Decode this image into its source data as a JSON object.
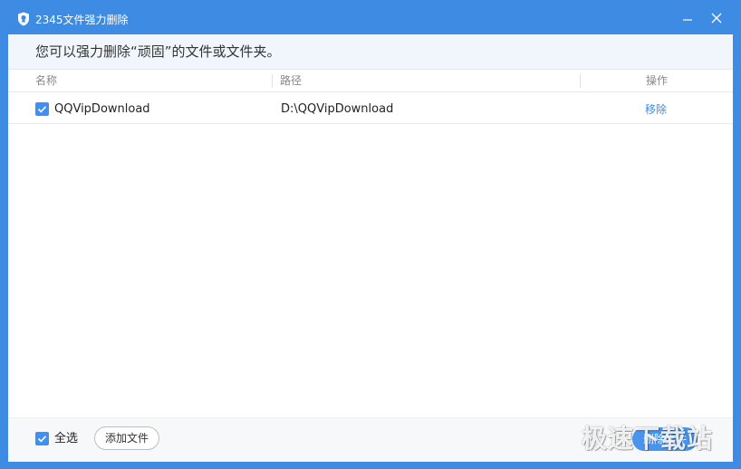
{
  "window": {
    "title": "2345文件强力删除",
    "icon": "shield-icon",
    "controls": [
      "minimize-icon",
      "close-icon"
    ]
  },
  "intro": {
    "text": "您可以强力删除“顽固”的文件或文件夹。"
  },
  "table": {
    "columns": [
      "名称",
      "路径",
      "操作"
    ],
    "rows": [
      {
        "checked": true,
        "name": "QQVipDownload",
        "path": "D:\\QQVipDownload",
        "action": "移除"
      }
    ]
  },
  "footer": {
    "select_all_label": "全选",
    "select_all_checked": true,
    "add_file_label": "添加文件",
    "delete_label": "删除文件"
  },
  "watermark": "极速下载站",
  "colors": {
    "titlebar": "#3d8be3",
    "accent": "#3f8ff5",
    "link": "#3a8ee6",
    "intro_bg": "#f1f6fd"
  }
}
